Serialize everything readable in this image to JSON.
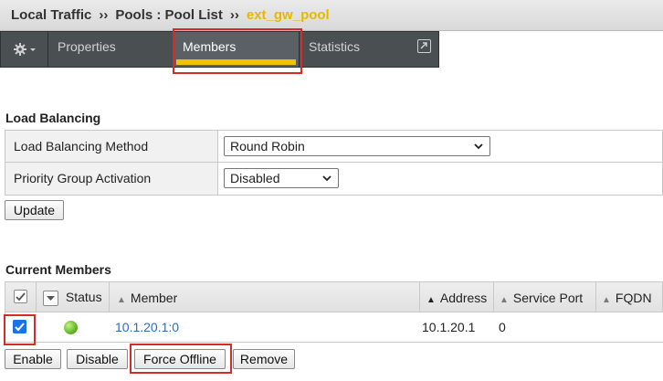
{
  "breadcrumb": {
    "section": "Local Traffic",
    "sep1": "››",
    "pools": "Pools : Pool List",
    "sep2": "››",
    "current": "ext_gw_pool"
  },
  "tabs": {
    "properties": "Properties",
    "members": "Members",
    "statistics": "Statistics"
  },
  "load_balancing": {
    "title": "Load Balancing",
    "method_label": "Load Balancing Method",
    "method_value": "Round Robin",
    "priority_label": "Priority Group Activation",
    "priority_value": "Disabled",
    "update_label": "Update"
  },
  "members": {
    "title": "Current Members",
    "columns": {
      "status": "Status",
      "member": "Member",
      "address": "Address",
      "service_port": "Service Port",
      "fqdn": "FQDN"
    },
    "rows": [
      {
        "member": "10.1.20.1:0",
        "address": "10.1.20.1",
        "service_port": "0",
        "status": "available",
        "checked": true
      }
    ],
    "actions": {
      "enable": "Enable",
      "disable": "Disable",
      "force_offline": "Force Offline",
      "remove": "Remove"
    }
  },
  "colors": {
    "highlight": "#d62b2b",
    "active_tab_underline": "#f2c200",
    "breadcrumb_current": "#e6b800",
    "link": "#2d6bbf"
  }
}
